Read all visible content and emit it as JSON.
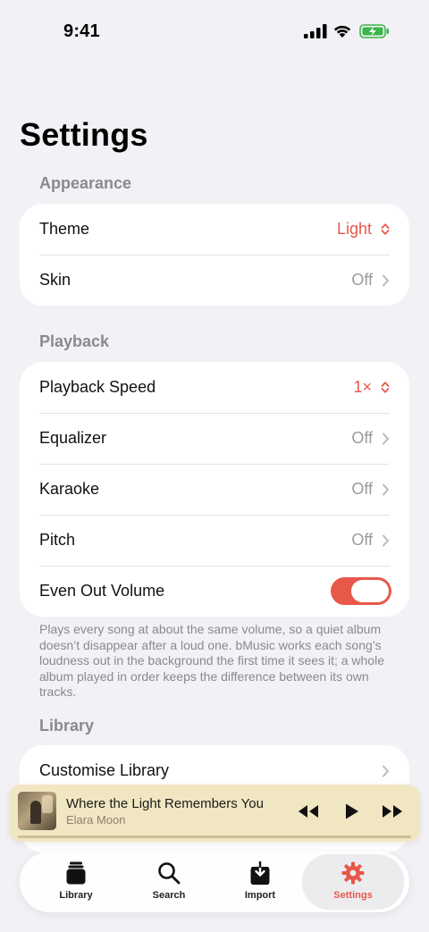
{
  "status_bar": {
    "time": "9:41"
  },
  "page_title": "Settings",
  "sections": {
    "appearance": {
      "header": "Appearance",
      "rows": [
        {
          "label": "Theme",
          "value": "Light"
        },
        {
          "label": "Skin",
          "value": "Off"
        }
      ]
    },
    "playback": {
      "header": "Playback",
      "rows": [
        {
          "label": "Playback Speed",
          "value": "1×"
        },
        {
          "label": "Equalizer",
          "value": "Off"
        },
        {
          "label": "Karaoke",
          "value": "Off"
        },
        {
          "label": "Pitch",
          "value": "Off"
        },
        {
          "label": "Even Out Volume",
          "toggle_on": true
        }
      ],
      "footnote": "Plays every song at about the same volume, so a quiet album doesn’t disappear after a loud one. bMusic works each song’s loudness out in the background the first time it sees it; a whole album played in order keeps the difference between its own tracks."
    },
    "library": {
      "header": "Library",
      "rows": [
        {
          "label": "Customise Library"
        }
      ]
    }
  },
  "now_playing": {
    "title": "Where the Light Remembers You",
    "artist": "Elara Moon",
    "controls": [
      "rewind-icon",
      "play-icon",
      "fast-forward-icon"
    ]
  },
  "tab_bar": {
    "tabs": [
      {
        "label": "Library",
        "icon": "library-icon"
      },
      {
        "label": "Search",
        "icon": "search-icon"
      },
      {
        "label": "Import",
        "icon": "import-icon"
      },
      {
        "label": "Settings",
        "icon": "gear-icon",
        "active": true
      }
    ]
  },
  "colors": {
    "accent": "#e8584a",
    "background": "#f2f2f6",
    "mini_player": "#f1e6c2"
  }
}
